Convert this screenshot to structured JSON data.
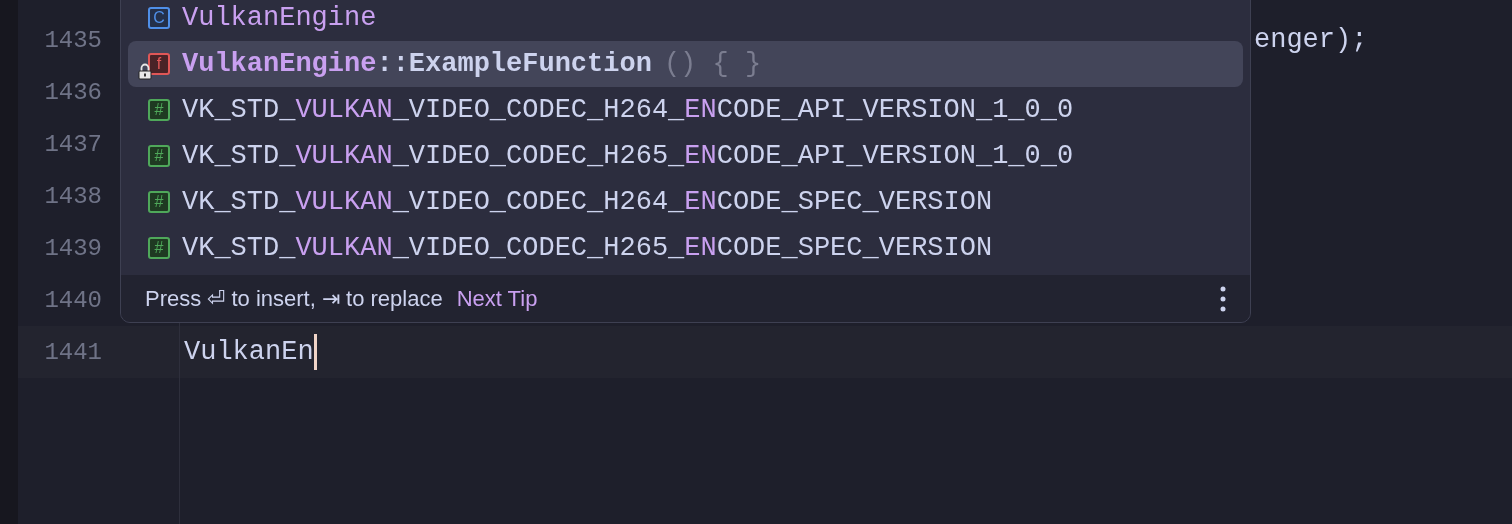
{
  "editor": {
    "lines": [
      {
        "number": "1435",
        "code": "enger);",
        "partial": true
      },
      {
        "number": "1436"
      },
      {
        "number": "1437"
      },
      {
        "number": "1438"
      },
      {
        "number": "1439"
      },
      {
        "number": "1440"
      },
      {
        "number": "1441",
        "code": "VulkanEn",
        "caret": true
      }
    ]
  },
  "completion": {
    "items": [
      {
        "kind": "class",
        "badge": "C",
        "locked": false,
        "selected": false,
        "bold": false,
        "segments": [
          {
            "text": "VulkanEngine",
            "match": true
          }
        ]
      },
      {
        "kind": "function",
        "badge": "f",
        "locked": true,
        "selected": true,
        "bold": true,
        "segments": [
          {
            "text": "VulkanEngine",
            "match": true
          },
          {
            "text": "::ExampleFunction",
            "match": false
          }
        ],
        "suffix": "() { }"
      },
      {
        "kind": "constant",
        "badge": "#",
        "locked": false,
        "selected": false,
        "bold": false,
        "segments": [
          {
            "text": "VK_STD_",
            "match": false
          },
          {
            "text": "VULKAN",
            "match": true
          },
          {
            "text": "_VIDEO_CODEC_H264_",
            "match": false
          },
          {
            "text": "EN",
            "match": true
          },
          {
            "text": "CODE_API_VERSION_1_0_0",
            "match": false
          }
        ]
      },
      {
        "kind": "constant",
        "badge": "#",
        "locked": false,
        "selected": false,
        "bold": false,
        "segments": [
          {
            "text": "VK_STD_",
            "match": false
          },
          {
            "text": "VULKAN",
            "match": true
          },
          {
            "text": "_VIDEO_CODEC_H265_",
            "match": false
          },
          {
            "text": "EN",
            "match": true
          },
          {
            "text": "CODE_API_VERSION_1_0_0",
            "match": false
          }
        ]
      },
      {
        "kind": "constant",
        "badge": "#",
        "locked": false,
        "selected": false,
        "bold": false,
        "segments": [
          {
            "text": "VK_STD_",
            "match": false
          },
          {
            "text": "VULKAN",
            "match": true
          },
          {
            "text": "_VIDEO_CODEC_H264_",
            "match": false
          },
          {
            "text": "EN",
            "match": true
          },
          {
            "text": "CODE_SPEC_VERSION",
            "match": false
          }
        ]
      },
      {
        "kind": "constant",
        "badge": "#",
        "locked": false,
        "selected": false,
        "bold": false,
        "segments": [
          {
            "text": "VK_STD_",
            "match": false
          },
          {
            "text": "VULKAN",
            "match": true
          },
          {
            "text": "_VIDEO_CODEC_H265_",
            "match": false
          },
          {
            "text": "EN",
            "match": true
          },
          {
            "text": "CODE_SPEC_VERSION",
            "match": false
          }
        ]
      }
    ],
    "footer": {
      "hint": "Press ⏎ to insert, ⇥ to replace",
      "link": "Next Tip"
    }
  }
}
